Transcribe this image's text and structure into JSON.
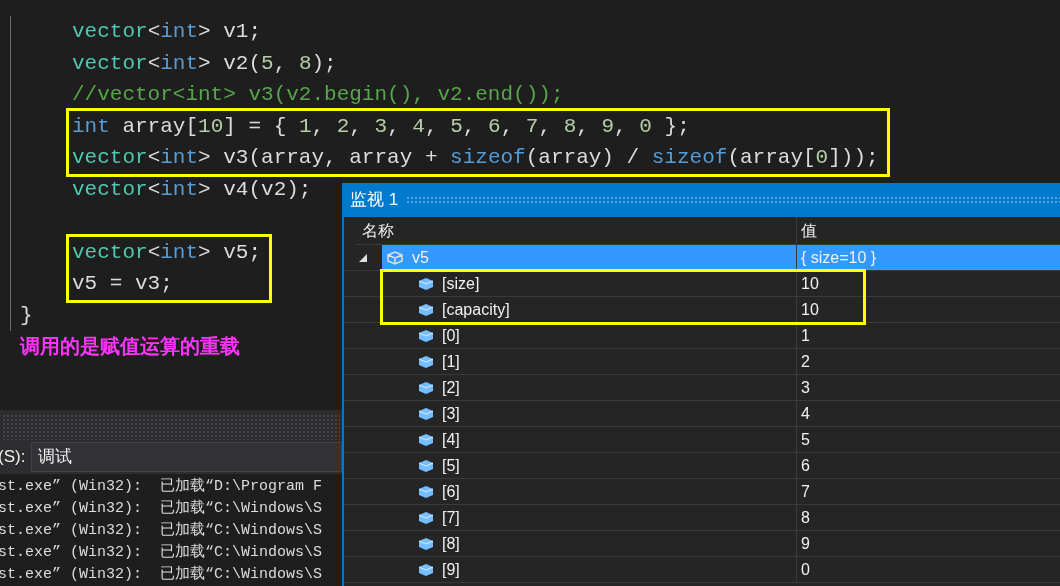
{
  "editor": {
    "function": {
      "body": [
        [
          {
            "highlighted": false,
            "lines": [
              [
                {
                  "text": "vector",
                  "kind": "type"
                },
                {
                  "text": "<",
                  "kind": "plain"
                },
                {
                  "text": "int",
                  "kind": "keyword"
                },
                {
                  "text": "> v1;",
                  "kind": "plain"
                }
              ],
              [
                {
                  "text": "vector",
                  "kind": "type"
                },
                {
                  "text": "<",
                  "kind": "plain"
                },
                {
                  "text": "int",
                  "kind": "keyword"
                },
                {
                  "text": "> v2(",
                  "kind": "plain"
                },
                {
                  "text": "5",
                  "kind": "number"
                },
                {
                  "text": ", ",
                  "kind": "plain"
                },
                {
                  "text": "8",
                  "kind": "number"
                },
                {
                  "text": ");",
                  "kind": "plain"
                }
              ],
              [
                {
                  "text": "//vector<int> v3(v2.begin(), v2.end());",
                  "kind": "comment"
                }
              ]
            ]
          },
          {
            "highlighted": true,
            "lines": [
              [
                {
                  "text": "int",
                  "kind": "keyword"
                },
                {
                  "text": " array[",
                  "kind": "plain"
                },
                {
                  "text": "10",
                  "kind": "number"
                },
                {
                  "text": "] = { ",
                  "kind": "plain"
                },
                {
                  "text": "1",
                  "kind": "number"
                },
                {
                  "text": ", ",
                  "kind": "plain"
                },
                {
                  "text": "2",
                  "kind": "number"
                },
                {
                  "text": ", ",
                  "kind": "plain"
                },
                {
                  "text": "3",
                  "kind": "number"
                },
                {
                  "text": ", ",
                  "kind": "plain"
                },
                {
                  "text": "4",
                  "kind": "number"
                },
                {
                  "text": ", ",
                  "kind": "plain"
                },
                {
                  "text": "5",
                  "kind": "number"
                },
                {
                  "text": ", ",
                  "kind": "plain"
                },
                {
                  "text": "6",
                  "kind": "number"
                },
                {
                  "text": ", ",
                  "kind": "plain"
                },
                {
                  "text": "7",
                  "kind": "number"
                },
                {
                  "text": ", ",
                  "kind": "plain"
                },
                {
                  "text": "8",
                  "kind": "number"
                },
                {
                  "text": ", ",
                  "kind": "plain"
                },
                {
                  "text": "9",
                  "kind": "number"
                },
                {
                  "text": ", ",
                  "kind": "plain"
                },
                {
                  "text": "0",
                  "kind": "number"
                },
                {
                  "text": " };",
                  "kind": "plain"
                }
              ],
              [
                {
                  "text": "vector",
                  "kind": "type"
                },
                {
                  "text": "<",
                  "kind": "plain"
                },
                {
                  "text": "int",
                  "kind": "keyword"
                },
                {
                  "text": "> v3(array, array + ",
                  "kind": "plain"
                },
                {
                  "text": "sizeof",
                  "kind": "keyword"
                },
                {
                  "text": "(array) / ",
                  "kind": "plain"
                },
                {
                  "text": "sizeof",
                  "kind": "keyword"
                },
                {
                  "text": "(array[",
                  "kind": "plain"
                },
                {
                  "text": "0",
                  "kind": "number"
                },
                {
                  "text": "]));",
                  "kind": "plain"
                }
              ]
            ]
          },
          {
            "highlighted": false,
            "lines": [
              [
                {
                  "text": "vector",
                  "kind": "type"
                },
                {
                  "text": "<",
                  "kind": "plain"
                },
                {
                  "text": "int",
                  "kind": "keyword"
                },
                {
                  "text": "> v4(v2);",
                  "kind": "plain"
                }
              ]
            ]
          }
        ],
        [
          {
            "highlighted": true,
            "lines": [
              [
                {
                  "text": "vector",
                  "kind": "type"
                },
                {
                  "text": "<",
                  "kind": "plain"
                },
                {
                  "text": "int",
                  "kind": "keyword"
                },
                {
                  "text": "> v5;",
                  "kind": "plain"
                }
              ],
              [
                {
                  "text": "v5 = v3;",
                  "kind": "plain"
                }
              ]
            ]
          }
        ]
      ],
      "closing_brace": "}"
    },
    "annotation": "调用的是赋值运算的重载"
  },
  "output": {
    "source_label": "(S):",
    "source_value": "调试",
    "lines": [
      "st.exe” (Win32):  已加载“D:\\Program F",
      "st.exe” (Win32):  已加载“C:\\Windows\\S",
      "st.exe” (Win32):  已加载“C:\\Windows\\S",
      "st.exe” (Win32):  已加载“C:\\Windows\\S",
      "st.exe” (Win32):  已加载“C:\\Windows\\S"
    ]
  },
  "watch": {
    "title": "监视 1",
    "columns": [
      "名称",
      "值"
    ],
    "items": [
      {
        "name": "v5",
        "value": "{ size=10 }",
        "kind": "object",
        "expanded": true,
        "selected": true,
        "children": [
          {
            "name": "[size]",
            "value": "10",
            "kind": "field",
            "selected": false,
            "highlighted": true
          },
          {
            "name": "[capacity]",
            "value": "10",
            "kind": "field",
            "selected": false,
            "highlighted": true
          },
          {
            "name": "[0]",
            "value": "1",
            "kind": "field",
            "selected": false,
            "highlighted": false
          },
          {
            "name": "[1]",
            "value": "2",
            "kind": "field",
            "selected": false,
            "highlighted": false
          },
          {
            "name": "[2]",
            "value": "3",
            "kind": "field",
            "selected": false,
            "highlighted": false
          },
          {
            "name": "[3]",
            "value": "4",
            "kind": "field",
            "selected": false,
            "highlighted": false
          },
          {
            "name": "[4]",
            "value": "5",
            "kind": "field",
            "selected": false,
            "highlighted": false
          },
          {
            "name": "[5]",
            "value": "6",
            "kind": "field",
            "selected": false,
            "highlighted": false
          },
          {
            "name": "[6]",
            "value": "7",
            "kind": "field",
            "selected": false,
            "highlighted": false
          },
          {
            "name": "[7]",
            "value": "8",
            "kind": "field",
            "selected": false,
            "highlighted": false
          },
          {
            "name": "[8]",
            "value": "9",
            "kind": "field",
            "selected": false,
            "highlighted": false
          },
          {
            "name": "[9]",
            "value": "0",
            "kind": "field",
            "selected": false,
            "highlighted": false
          }
        ]
      }
    ]
  }
}
